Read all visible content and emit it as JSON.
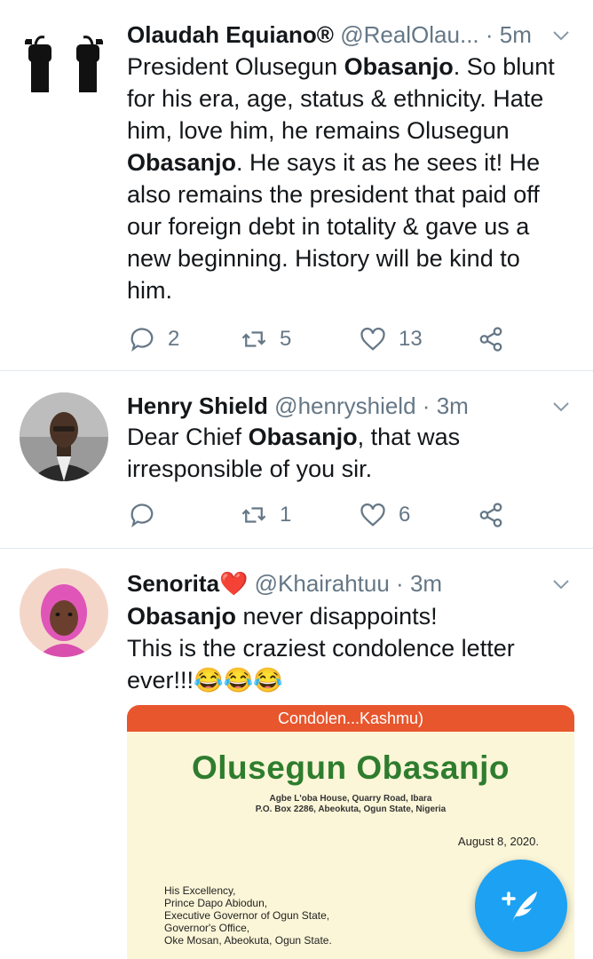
{
  "tweets": [
    {
      "name": "Olaudah Equiano®",
      "handle": "@RealOlau...",
      "dot": "·",
      "time": "5m",
      "text_parts": [
        "President Olusegun ",
        "Obasanjo",
        ". So blunt for his era, age, status & ethnicity. Hate him, love him, he remains Olusegun ",
        "Obasanjo",
        ". He says it as he sees it! He also remains the president that paid off our foreign debt in totality & gave us a new beginning. History will be kind to him."
      ],
      "replies": "2",
      "retweets": "5",
      "likes": "13"
    },
    {
      "name": "Henry Shield",
      "handle": "@henryshield",
      "dot": "·",
      "time": "3m",
      "text_parts": [
        "Dear Chief ",
        "Obasanjo",
        ", that was irresponsible of you sir."
      ],
      "replies": "",
      "retweets": "1",
      "likes": "6"
    },
    {
      "name": "Senorita❤️",
      "handle": "@Khairahtuu",
      "dot": "·",
      "time": "3m",
      "line1_bold": "Obasanjo",
      "line1_rest": " never disappoints!",
      "line2": "This is the craziest condolence letter",
      "line3": "ever!!!😂😂😂",
      "media": {
        "bar_text": "Condolen...Kashmu)",
        "letterhead_name": "Olusegun Obasanjo",
        "address_line1": "Agbe L'oba House, Quarry Road, Ibara",
        "address_line2": "P.O. Box 2286, Abeokuta, Ogun State, Nigeria",
        "date": "August 8, 2020.",
        "recipient": [
          "His Excellency,",
          "Prince Dapo Abiodun,",
          "Executive Governor of Ogun State,",
          "Governor's Office,",
          "Oke Mosan, Abeokuta, Ogun State."
        ]
      }
    }
  ],
  "colors": {
    "accent": "#1da1f2",
    "secondary_text": "#657786",
    "divider": "#e1e8ed",
    "letter_bar": "#e8562d",
    "letterhead_green": "#2e7d2e"
  },
  "icons": {
    "reply": "reply-icon",
    "retweet": "retweet-icon",
    "like": "heart-icon",
    "share": "share-icon",
    "caret": "chevron-down-icon",
    "compose": "compose-tweet-icon"
  }
}
